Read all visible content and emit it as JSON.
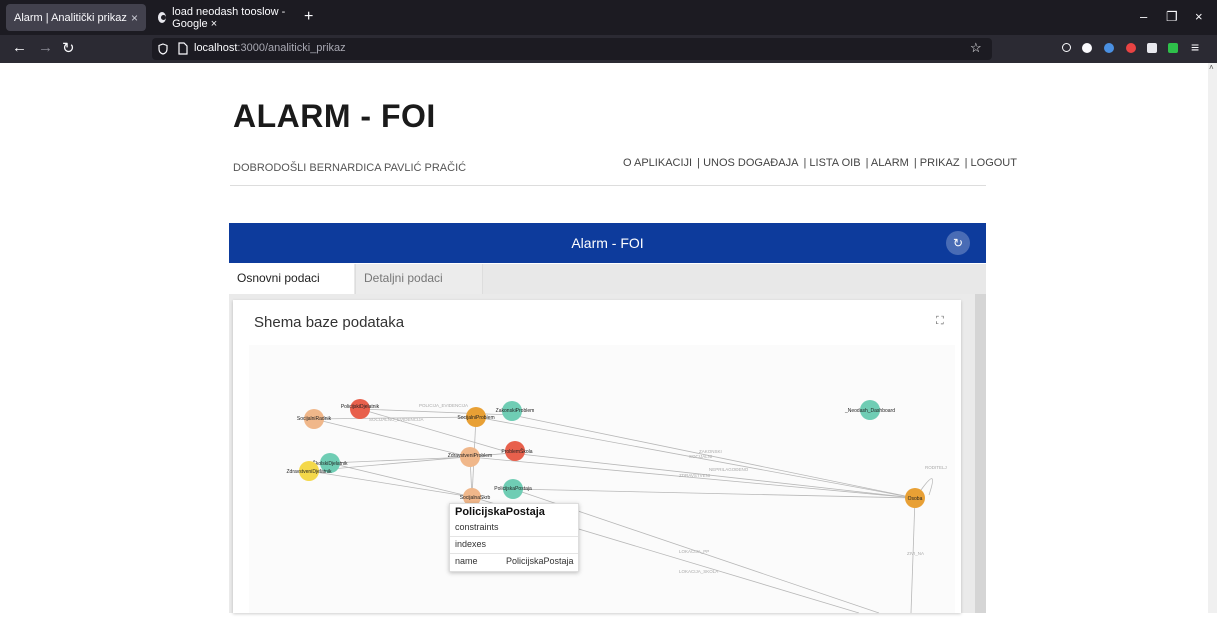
{
  "browser": {
    "tabs": [
      {
        "title": "Alarm | Analitički prikaz",
        "close": "×"
      },
      {
        "title": "load neodash tooslow - Google ×",
        "close": ""
      }
    ],
    "new_tab": "+",
    "url_host": "localhost",
    "url_path": ":3000/analiticki_prikaz"
  },
  "page": {
    "logo": "ALARM - FOI",
    "welcome": "DOBRODOŠLI BERNARDICA PAVLIĆ PRAČIĆ",
    "nav": [
      "O APLIKACIJI",
      "| UNOS DOGAĐAJA",
      "| LISTA OIB",
      "| ALARM",
      "| PRIKAZ",
      "| LOGOUT"
    ]
  },
  "app": {
    "title": "Alarm - FOI",
    "tabs": [
      "Osnovni podaci",
      "Detaljni podaci"
    ],
    "card_title": "Shema baze podataka"
  },
  "graph": {
    "nodes": [
      {
        "label": "PolicijskiDjelatnik",
        "color": "#e8604c"
      },
      {
        "label": "SocijalniRadnik",
        "color": "#f0b78a"
      },
      {
        "label": "SocijalniProblem",
        "color": "#e8a035"
      },
      {
        "label": "ZakonskiProblem",
        "color": "#6fcdb4"
      },
      {
        "label": "_Neodash_Dashboard",
        "color": "#6fcdb4"
      },
      {
        "label": "ProblemŠkola",
        "color": "#e8604c"
      },
      {
        "label": "ZdravstveniProblem",
        "color": "#f0b78a"
      },
      {
        "label": "ŠkolskiDjelatnik",
        "color": "#6fcdb4"
      },
      {
        "label": "ZdravstveniDjelatnik",
        "color": "#f4d84a"
      },
      {
        "label": "PolicijskaPostaja",
        "color": "#6fcdb4"
      },
      {
        "label": "SocijalnaSkrb",
        "color": "#f0b78a"
      },
      {
        "label": "Osoba",
        "color": "#e8a035"
      }
    ],
    "edge_labels": [
      "POLICIJA_EVIDENCIJA",
      "SOCIJALNO_EVIDENCIJA",
      "ZAKONSKI",
      "SOCIJALNI",
      "NEPRILAGOĐENO",
      "ZDRAVSTVENI",
      "LOKACIJA_PP",
      "LOKACIJA_SKOLA",
      "ZIVI_NA",
      "RODITELJ"
    ],
    "tooltip": {
      "title": "PolicijskaPostaja",
      "rows": [
        "constraints",
        "indexes"
      ],
      "name_key": "name",
      "name_value": "PolicijskaPostaja"
    }
  },
  "icons": [
    "back-arrow-icon",
    "forward-arrow-icon",
    "reload-icon",
    "shield-icon",
    "page-icon",
    "star-icon",
    "fullscreen-icon",
    "schema-toggle-icon"
  ]
}
